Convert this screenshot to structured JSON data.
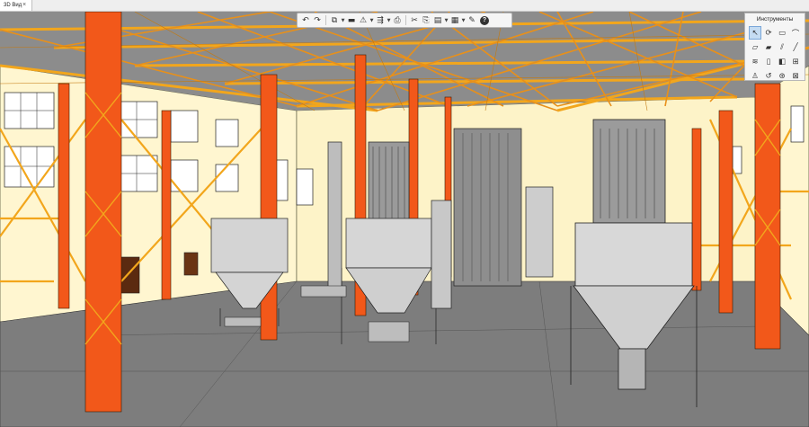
{
  "tab": {
    "label": "3D Вид",
    "close": "×"
  },
  "toolbar": {
    "buttons": [
      {
        "name": "undo",
        "glyph": "↶"
      },
      {
        "name": "redo",
        "glyph": "↷"
      },
      {
        "name": "copy-view",
        "glyph": "⧉"
      },
      {
        "name": "folder",
        "glyph": "▬"
      },
      {
        "name": "warning",
        "glyph": "⚠"
      },
      {
        "name": "export",
        "glyph": "⇶"
      },
      {
        "name": "print",
        "glyph": "⎙"
      },
      {
        "name": "cut",
        "glyph": "✂"
      },
      {
        "name": "copy",
        "glyph": "⎘"
      },
      {
        "name": "paste",
        "glyph": "▤"
      },
      {
        "name": "layers",
        "glyph": "▦"
      },
      {
        "name": "settings",
        "glyph": "✎"
      },
      {
        "name": "help",
        "glyph": "?"
      }
    ]
  },
  "tools": {
    "title": "Инструменты",
    "items": [
      {
        "name": "select",
        "glyph": "↖"
      },
      {
        "name": "rotate",
        "glyph": "⟳"
      },
      {
        "name": "rectangle",
        "glyph": "▭"
      },
      {
        "name": "bracket",
        "glyph": "⌒"
      },
      {
        "name": "slab",
        "glyph": "▱"
      },
      {
        "name": "wall",
        "glyph": "▰"
      },
      {
        "name": "beam",
        "glyph": "⫽"
      },
      {
        "name": "line",
        "glyph": "╱"
      },
      {
        "name": "stair",
        "glyph": "≋"
      },
      {
        "name": "column",
        "glyph": "▯"
      },
      {
        "name": "door",
        "glyph": "◧"
      },
      {
        "name": "window",
        "glyph": "⊞"
      },
      {
        "name": "pump",
        "glyph": "♙"
      },
      {
        "name": "pipe",
        "glyph": "↺"
      },
      {
        "name": "tag",
        "glyph": "⊛"
      },
      {
        "name": "fitting",
        "glyph": "⊠"
      }
    ]
  }
}
